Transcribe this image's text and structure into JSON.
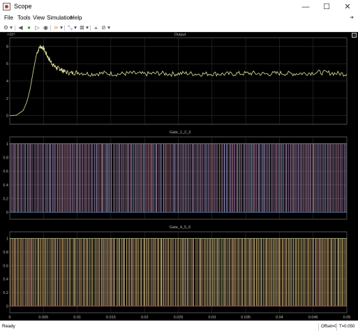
{
  "window": {
    "title": "Scope",
    "controls": {
      "minimize": "—",
      "maximize": "☐",
      "close": "✕"
    }
  },
  "menu": [
    "File",
    "Tools",
    "View",
    "Simulation",
    "Help"
  ],
  "toolbar": [
    "gear-icon",
    "step-back-icon",
    "run-icon",
    "step-forward-icon",
    "stop-icon",
    "highlight-icon",
    "zoom-icon",
    "axes-scale-icon",
    "triggers-icon",
    "measure-icon"
  ],
  "plots": [
    {
      "title": "Output",
      "exponent_label": "×10⁴"
    },
    {
      "title": "Gate_1_2_3"
    },
    {
      "title": "Gate_4_5_6"
    }
  ],
  "status": {
    "text": "Ready",
    "offset": "Offset=0",
    "time": "T=0.050"
  },
  "colors": {
    "output_trace": "#e6e6a0",
    "gate_a": "#6aa0d8",
    "gate_b": "#e08080",
    "gate_c": "#e8c860",
    "gate_d": "#f0f0b0",
    "grid": "#3a3a3a"
  },
  "chart_data": [
    {
      "type": "line",
      "title": "Output",
      "xlim": [
        0,
        0.05
      ],
      "ylim": [
        -1,
        9
      ],
      "x_ticks": [
        "0",
        "0.005",
        "0.01",
        "0.015",
        "0.02",
        "0.025",
        "0.03",
        "0.035",
        "0.04",
        "0.045",
        "0.05"
      ],
      "y_ticks": [
        "0",
        "2",
        "4",
        "6",
        "8"
      ],
      "y_exponent": "×10⁴",
      "series": [
        {
          "x": [
            0,
            0.001,
            0.002,
            0.0025,
            0.003,
            0.0035,
            0.004,
            0.0045,
            0.005,
            0.0055,
            0.006,
            0.0065,
            0.007,
            0.0075,
            0.008,
            0.009,
            0.01,
            0.012,
            0.014,
            0.016,
            0.018,
            0.02,
            0.022,
            0.024,
            0.026,
            0.028,
            0.03,
            0.032,
            0.034,
            0.036,
            0.038,
            0.04,
            0.042,
            0.044,
            0.046,
            0.048,
            0.05
          ],
          "y": [
            0,
            0.05,
            0.6,
            1.5,
            3.0,
            5.2,
            7.2,
            8.0,
            7.8,
            7.0,
            6.3,
            5.8,
            5.5,
            5.4,
            5.1,
            4.9,
            5.0,
            4.8,
            4.9,
            4.8,
            4.9,
            4.8,
            4.9,
            4.8,
            4.9,
            4.8,
            4.85,
            4.8,
            4.85,
            4.9,
            4.8,
            4.9,
            4.85,
            4.9,
            5.0,
            4.9,
            4.8
          ]
        }
      ]
    },
    {
      "type": "line",
      "title": "Gate_1_2_3",
      "xlim": [
        0,
        0.05
      ],
      "ylim": [
        -0.1,
        1.1
      ],
      "y_ticks": [
        "0",
        "0.2",
        "0.4",
        "0.6",
        "0.8",
        "1"
      ],
      "series": [
        {
          "name": "",
          "pulse_frequency_hz": 4000,
          "values": [
            0,
            1
          ]
        },
        {
          "name": "",
          "pulse_frequency_hz": 4000,
          "values": [
            0,
            1
          ]
        },
        {
          "name": "",
          "pulse_frequency_hz": 4000,
          "values": [
            0,
            1
          ]
        }
      ]
    },
    {
      "type": "line",
      "title": "Gate_4_5_6",
      "xlim": [
        0,
        0.05
      ],
      "ylim": [
        -0.1,
        1.1
      ],
      "y_ticks": [
        "0",
        "0.2",
        "0.4",
        "0.6",
        "0.8",
        "1"
      ],
      "series": [
        {
          "name": "",
          "pulse_frequency_hz": 4000,
          "values": [
            0,
            1
          ]
        },
        {
          "name": "",
          "pulse_frequency_hz": 4000,
          "values": [
            0,
            1
          ]
        },
        {
          "name": "",
          "pulse_frequency_hz": 4000,
          "values": [
            0,
            1
          ]
        }
      ]
    }
  ]
}
